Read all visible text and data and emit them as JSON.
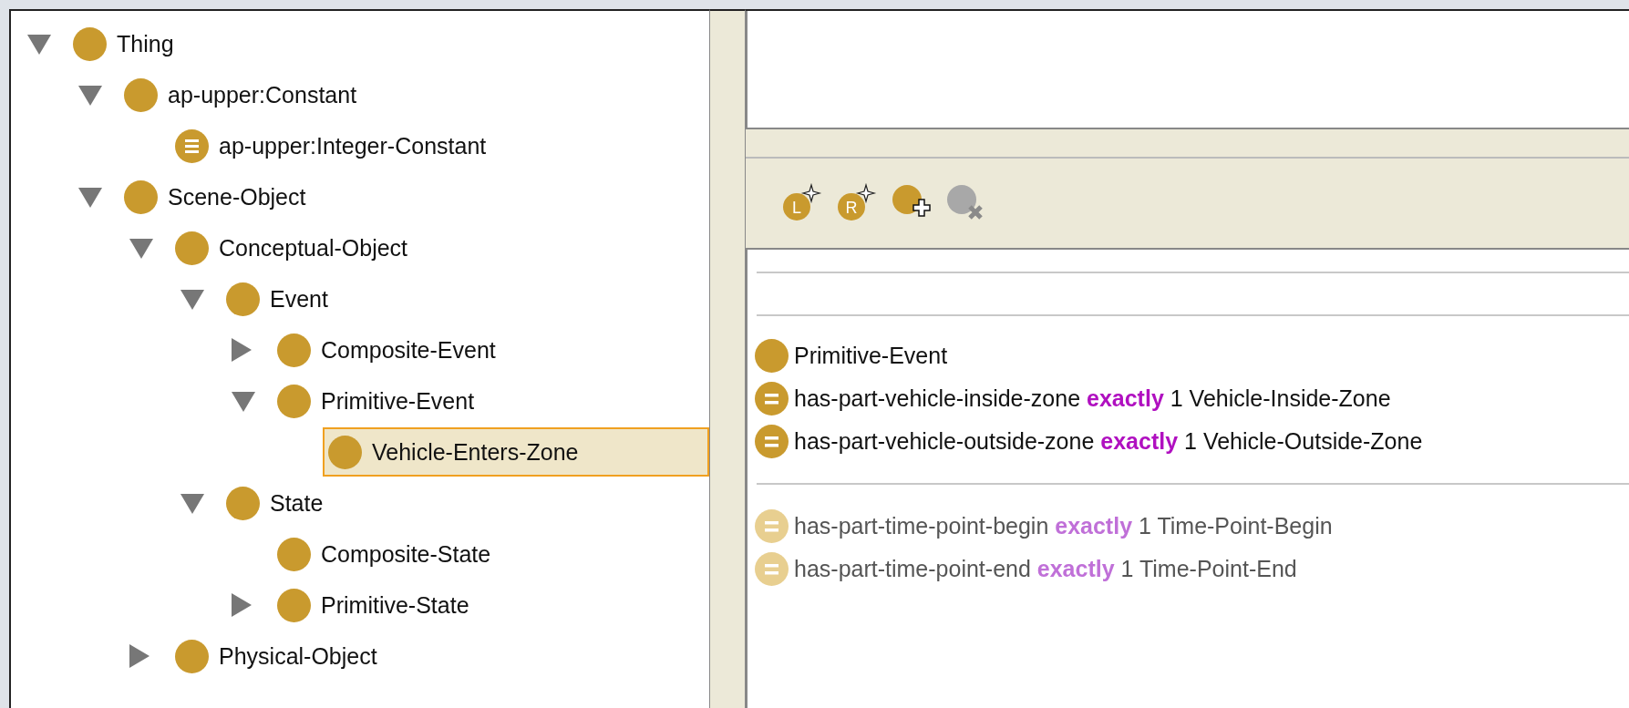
{
  "tree": [
    {
      "label": "Thing",
      "kind": "class",
      "expanded": true,
      "selected": false,
      "children": [
        {
          "label": "ap-upper:Constant",
          "kind": "class",
          "expanded": true,
          "selected": false,
          "children": [
            {
              "label": "ap-upper:Integer-Constant",
              "kind": "defined",
              "selected": false
            }
          ]
        },
        {
          "label": "Scene-Object",
          "kind": "class",
          "expanded": true,
          "selected": false,
          "children": [
            {
              "label": "Conceptual-Object",
              "kind": "class",
              "expanded": true,
              "selected": false,
              "children": [
                {
                  "label": "Event",
                  "kind": "class",
                  "expanded": true,
                  "selected": false,
                  "children": [
                    {
                      "label": "Composite-Event",
                      "kind": "class",
                      "expanded": false,
                      "selected": false
                    },
                    {
                      "label": "Primitive-Event",
                      "kind": "class",
                      "expanded": true,
                      "selected": false,
                      "children": [
                        {
                          "label": "Vehicle-Enters-Zone",
                          "kind": "class",
                          "selected": true
                        }
                      ]
                    }
                  ]
                },
                {
                  "label": "State",
                  "kind": "class",
                  "expanded": true,
                  "selected": false,
                  "children": [
                    {
                      "label": "Composite-State",
                      "kind": "class",
                      "selected": false
                    },
                    {
                      "label": "Primitive-State",
                      "kind": "class",
                      "expanded": false,
                      "selected": false
                    }
                  ]
                }
              ]
            },
            {
              "label": "Physical-Object",
              "kind": "class",
              "expanded": false,
              "selected": false
            }
          ]
        }
      ]
    }
  ],
  "toolbar": [
    {
      "kind": "badge-add",
      "badge": "L",
      "disabled": false
    },
    {
      "kind": "badge-add",
      "badge": "R",
      "disabled": false
    },
    {
      "kind": "class-add",
      "disabled": false
    },
    {
      "kind": "class-delete",
      "disabled": true
    }
  ],
  "superclasses": [
    {
      "kind": "class",
      "label": "Primitive-Event",
      "inherited": false
    },
    {
      "kind": "restriction",
      "property": "has-part-vehicle-inside-zone",
      "keyword": "exactly",
      "cardinality": "1",
      "filler": "Vehicle-Inside-Zone",
      "inherited": false
    },
    {
      "kind": "restriction",
      "property": "has-part-vehicle-outside-zone",
      "keyword": "exactly",
      "cardinality": "1",
      "filler": "Vehicle-Outside-Zone",
      "inherited": false
    },
    {
      "kind": "separator"
    },
    {
      "kind": "restriction",
      "property": "has-part-time-point-begin",
      "keyword": "exactly",
      "cardinality": "1",
      "filler": "Time-Point-Begin",
      "inherited": true
    },
    {
      "kind": "restriction",
      "property": "has-part-time-point-end",
      "keyword": "exactly",
      "cardinality": "1",
      "filler": "Time-Point-End",
      "inherited": true
    }
  ]
}
